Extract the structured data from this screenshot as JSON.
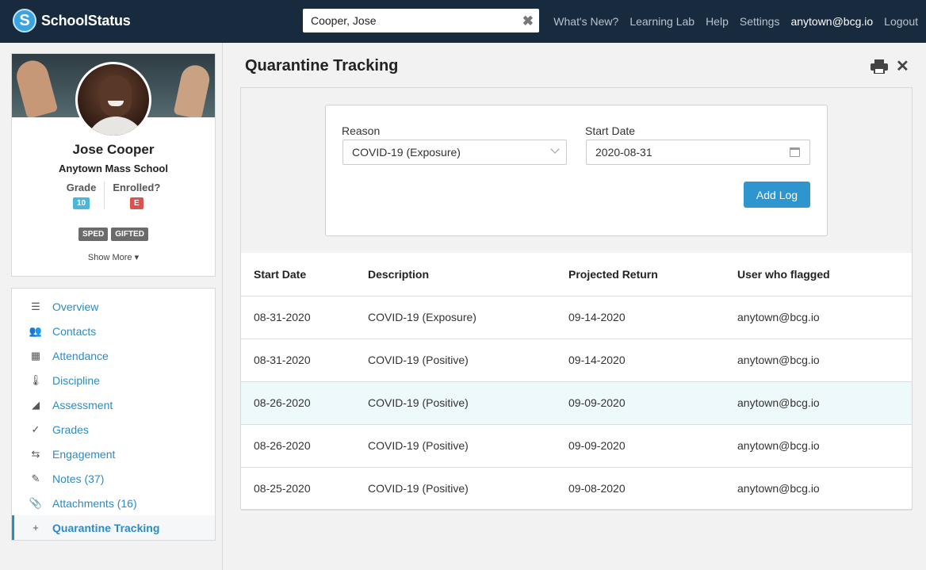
{
  "app": {
    "name": "SchoolStatus",
    "logo_letter": "S"
  },
  "search": {
    "value": "Cooper, Jose",
    "clear_glyph": "✖"
  },
  "nav": [
    "What's New?",
    "Learning Lab",
    "Help",
    "Settings"
  ],
  "user": {
    "email": "anytown@bcg.io",
    "logout": "Logout"
  },
  "profile": {
    "name": "Jose Cooper",
    "school": "Anytown Mass School",
    "grade_label": "Grade",
    "grade_value": "10",
    "enrolled_label": "Enrolled?",
    "enrolled_value": "E",
    "tags": [
      "SPED",
      "GIFTED"
    ],
    "show_more": "Show More ▾"
  },
  "sidebar": {
    "items": [
      {
        "label": "Overview",
        "icon": "list-icon",
        "glyph": "☰"
      },
      {
        "label": "Contacts",
        "icon": "contacts-icon",
        "glyph": "👥"
      },
      {
        "label": "Attendance",
        "icon": "calendar-icon",
        "glyph": "▦"
      },
      {
        "label": "Discipline",
        "icon": "thermometer-icon",
        "glyph": "🌡"
      },
      {
        "label": "Assessment",
        "icon": "area-chart-icon",
        "glyph": "◢"
      },
      {
        "label": "Grades",
        "icon": "checkmark-icon",
        "glyph": "✓"
      },
      {
        "label": "Engagement",
        "icon": "exchange-icon",
        "glyph": "⇆"
      },
      {
        "label": "Notes (37)",
        "icon": "pencil-icon",
        "glyph": "✎"
      },
      {
        "label": "Attachments (16)",
        "icon": "paperclip-icon",
        "glyph": "📎"
      },
      {
        "label": "Quarantine Tracking",
        "icon": "plus-icon",
        "glyph": "+"
      }
    ],
    "active_index": 9
  },
  "main": {
    "title": "Quarantine Tracking",
    "close_glyph": "✕"
  },
  "form": {
    "reason_label": "Reason",
    "reason_value": "COVID-19 (Exposure)",
    "start_label": "Start Date",
    "start_value": "2020-08-31",
    "add_button": "Add Log"
  },
  "table": {
    "headers": [
      "Start Date",
      "Description",
      "Projected Return",
      "User who flagged"
    ],
    "rows": [
      [
        "08-31-2020",
        "COVID-19 (Exposure)",
        "09-14-2020",
        "anytown@bcg.io"
      ],
      [
        "08-31-2020",
        "COVID-19 (Positive)",
        "09-14-2020",
        "anytown@bcg.io"
      ],
      [
        "08-26-2020",
        "COVID-19 (Positive)",
        "09-09-2020",
        "anytown@bcg.io"
      ],
      [
        "08-26-2020",
        "COVID-19 (Positive)",
        "09-09-2020",
        "anytown@bcg.io"
      ],
      [
        "08-25-2020",
        "COVID-19 (Positive)",
        "09-08-2020",
        "anytown@bcg.io"
      ]
    ],
    "highlight_row": 2
  },
  "colors": {
    "nav_bg": "#182a3e",
    "accent": "#2b8bc6",
    "button": "#2f95cf",
    "row_highlight": "#eef9fc"
  }
}
